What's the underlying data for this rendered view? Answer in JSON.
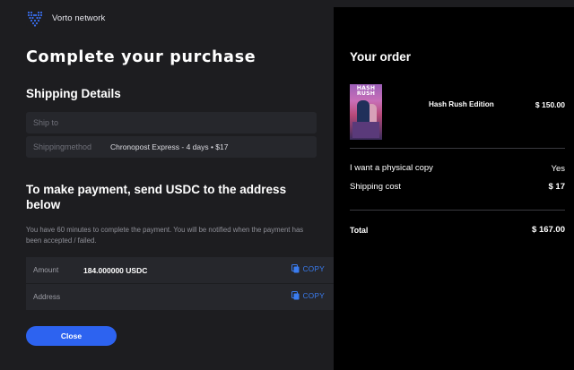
{
  "brand": {
    "name": "Vorto network"
  },
  "page": {
    "title": "Complete your purchase"
  },
  "shipping": {
    "section_title": "Shipping Details",
    "ship_to_placeholder": "Ship to",
    "method_label": "Shippingmethod",
    "method_value": "Chronopost Express - 4 days • $17"
  },
  "payment": {
    "title": "To make payment, send USDC to the address below",
    "note": "You have 60 minutes to complete the payment. You will be notified when the payment has been accepted / failed.",
    "amount_label": "Amount",
    "amount_value": "184.000000 USDC",
    "address_label": "Address",
    "address_value": "",
    "copy_label": "COPY"
  },
  "actions": {
    "close_label": "Close"
  },
  "order": {
    "title": "Your order",
    "cover_title": "HASH RUSH",
    "item_name": "Hash Rush Edition",
    "item_price": "$ 150.00",
    "physical_label": "I want a physical copy",
    "physical_value": "Yes",
    "shipping_label": "Shipping cost",
    "shipping_value": "$ 17",
    "total_label": "Total",
    "total_value": "$ 167.00"
  },
  "colors": {
    "accent": "#2d63f0",
    "copy_link": "#3a7cf0",
    "left_bg": "#1d1d20",
    "right_bg": "#000000"
  },
  "icons": [
    "vorto-logo-icon",
    "copy-icon"
  ]
}
